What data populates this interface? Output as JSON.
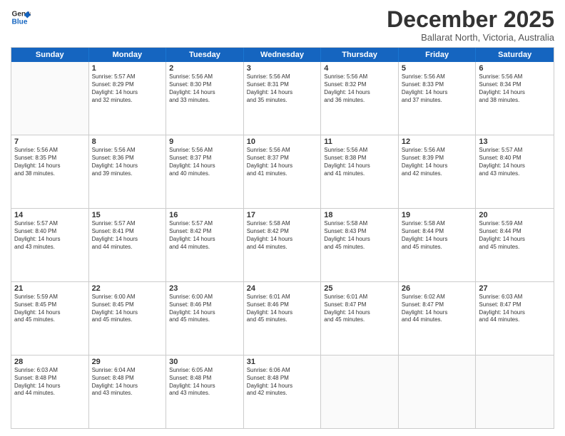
{
  "logo": {
    "line1": "General",
    "line2": "Blue"
  },
  "title": "December 2025",
  "subtitle": "Ballarat North, Victoria, Australia",
  "days": [
    "Sunday",
    "Monday",
    "Tuesday",
    "Wednesday",
    "Thursday",
    "Friday",
    "Saturday"
  ],
  "rows": [
    [
      {
        "day": "",
        "lines": []
      },
      {
        "day": "1",
        "lines": [
          "Sunrise: 5:57 AM",
          "Sunset: 8:29 PM",
          "Daylight: 14 hours",
          "and 32 minutes."
        ]
      },
      {
        "day": "2",
        "lines": [
          "Sunrise: 5:56 AM",
          "Sunset: 8:30 PM",
          "Daylight: 14 hours",
          "and 33 minutes."
        ]
      },
      {
        "day": "3",
        "lines": [
          "Sunrise: 5:56 AM",
          "Sunset: 8:31 PM",
          "Daylight: 14 hours",
          "and 35 minutes."
        ]
      },
      {
        "day": "4",
        "lines": [
          "Sunrise: 5:56 AM",
          "Sunset: 8:32 PM",
          "Daylight: 14 hours",
          "and 36 minutes."
        ]
      },
      {
        "day": "5",
        "lines": [
          "Sunrise: 5:56 AM",
          "Sunset: 8:33 PM",
          "Daylight: 14 hours",
          "and 37 minutes."
        ]
      },
      {
        "day": "6",
        "lines": [
          "Sunrise: 5:56 AM",
          "Sunset: 8:34 PM",
          "Daylight: 14 hours",
          "and 38 minutes."
        ]
      }
    ],
    [
      {
        "day": "7",
        "lines": [
          "Sunrise: 5:56 AM",
          "Sunset: 8:35 PM",
          "Daylight: 14 hours",
          "and 38 minutes."
        ]
      },
      {
        "day": "8",
        "lines": [
          "Sunrise: 5:56 AM",
          "Sunset: 8:36 PM",
          "Daylight: 14 hours",
          "and 39 minutes."
        ]
      },
      {
        "day": "9",
        "lines": [
          "Sunrise: 5:56 AM",
          "Sunset: 8:37 PM",
          "Daylight: 14 hours",
          "and 40 minutes."
        ]
      },
      {
        "day": "10",
        "lines": [
          "Sunrise: 5:56 AM",
          "Sunset: 8:37 PM",
          "Daylight: 14 hours",
          "and 41 minutes."
        ]
      },
      {
        "day": "11",
        "lines": [
          "Sunrise: 5:56 AM",
          "Sunset: 8:38 PM",
          "Daylight: 14 hours",
          "and 41 minutes."
        ]
      },
      {
        "day": "12",
        "lines": [
          "Sunrise: 5:56 AM",
          "Sunset: 8:39 PM",
          "Daylight: 14 hours",
          "and 42 minutes."
        ]
      },
      {
        "day": "13",
        "lines": [
          "Sunrise: 5:57 AM",
          "Sunset: 8:40 PM",
          "Daylight: 14 hours",
          "and 43 minutes."
        ]
      }
    ],
    [
      {
        "day": "14",
        "lines": [
          "Sunrise: 5:57 AM",
          "Sunset: 8:40 PM",
          "Daylight: 14 hours",
          "and 43 minutes."
        ]
      },
      {
        "day": "15",
        "lines": [
          "Sunrise: 5:57 AM",
          "Sunset: 8:41 PM",
          "Daylight: 14 hours",
          "and 44 minutes."
        ]
      },
      {
        "day": "16",
        "lines": [
          "Sunrise: 5:57 AM",
          "Sunset: 8:42 PM",
          "Daylight: 14 hours",
          "and 44 minutes."
        ]
      },
      {
        "day": "17",
        "lines": [
          "Sunrise: 5:58 AM",
          "Sunset: 8:42 PM",
          "Daylight: 14 hours",
          "and 44 minutes."
        ]
      },
      {
        "day": "18",
        "lines": [
          "Sunrise: 5:58 AM",
          "Sunset: 8:43 PM",
          "Daylight: 14 hours",
          "and 45 minutes."
        ]
      },
      {
        "day": "19",
        "lines": [
          "Sunrise: 5:58 AM",
          "Sunset: 8:44 PM",
          "Daylight: 14 hours",
          "and 45 minutes."
        ]
      },
      {
        "day": "20",
        "lines": [
          "Sunrise: 5:59 AM",
          "Sunset: 8:44 PM",
          "Daylight: 14 hours",
          "and 45 minutes."
        ]
      }
    ],
    [
      {
        "day": "21",
        "lines": [
          "Sunrise: 5:59 AM",
          "Sunset: 8:45 PM",
          "Daylight: 14 hours",
          "and 45 minutes."
        ]
      },
      {
        "day": "22",
        "lines": [
          "Sunrise: 6:00 AM",
          "Sunset: 8:45 PM",
          "Daylight: 14 hours",
          "and 45 minutes."
        ]
      },
      {
        "day": "23",
        "lines": [
          "Sunrise: 6:00 AM",
          "Sunset: 8:46 PM",
          "Daylight: 14 hours",
          "and 45 minutes."
        ]
      },
      {
        "day": "24",
        "lines": [
          "Sunrise: 6:01 AM",
          "Sunset: 8:46 PM",
          "Daylight: 14 hours",
          "and 45 minutes."
        ]
      },
      {
        "day": "25",
        "lines": [
          "Sunrise: 6:01 AM",
          "Sunset: 8:47 PM",
          "Daylight: 14 hours",
          "and 45 minutes."
        ]
      },
      {
        "day": "26",
        "lines": [
          "Sunrise: 6:02 AM",
          "Sunset: 8:47 PM",
          "Daylight: 14 hours",
          "and 44 minutes."
        ]
      },
      {
        "day": "27",
        "lines": [
          "Sunrise: 6:03 AM",
          "Sunset: 8:47 PM",
          "Daylight: 14 hours",
          "and 44 minutes."
        ]
      }
    ],
    [
      {
        "day": "28",
        "lines": [
          "Sunrise: 6:03 AM",
          "Sunset: 8:48 PM",
          "Daylight: 14 hours",
          "and 44 minutes."
        ]
      },
      {
        "day": "29",
        "lines": [
          "Sunrise: 6:04 AM",
          "Sunset: 8:48 PM",
          "Daylight: 14 hours",
          "and 43 minutes."
        ]
      },
      {
        "day": "30",
        "lines": [
          "Sunrise: 6:05 AM",
          "Sunset: 8:48 PM",
          "Daylight: 14 hours",
          "and 43 minutes."
        ]
      },
      {
        "day": "31",
        "lines": [
          "Sunrise: 6:06 AM",
          "Sunset: 8:48 PM",
          "Daylight: 14 hours",
          "and 42 minutes."
        ]
      },
      {
        "day": "",
        "lines": []
      },
      {
        "day": "",
        "lines": []
      },
      {
        "day": "",
        "lines": []
      }
    ]
  ]
}
